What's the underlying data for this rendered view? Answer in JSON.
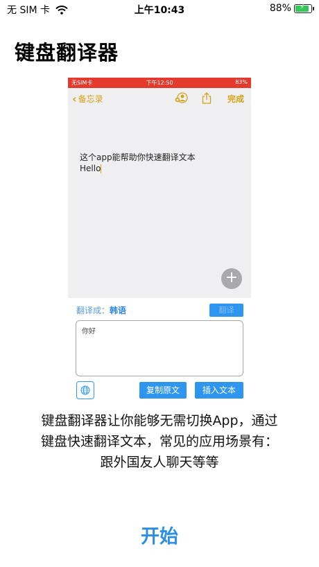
{
  "status_bar": {
    "carrier": "无 SIM 卡",
    "time": "上午10:43",
    "battery": "88%",
    "battery_level": 0.88,
    "battery_color": "#34c759"
  },
  "page_title": "键盘翻译器",
  "preview": {
    "status": {
      "carrier": "无SIM卡",
      "time": "下午12:50",
      "battery": "83%",
      "bar_color": "#e23b2e"
    },
    "nav": {
      "back_label": "备忘录",
      "done_label": "完成"
    },
    "note_line1": "这个app能帮助你快速翻译文本",
    "note_line2": "Hello",
    "fab_symbol": "+",
    "translate_to_label": "翻译成：",
    "target_language": "韩语",
    "translate_button": "翻译",
    "result_text": "你好",
    "copy_original_button": "复制原文",
    "insert_text_button": "插入文本",
    "accent_color": "#2f96ef"
  },
  "description": {
    "line1": "键盘翻译器让你能够无需切换App，通过",
    "line2": "键盘快速翻译文本，常见的应用场景有：",
    "line3": "跟外国友人聊天等等"
  },
  "start_button": "开始"
}
